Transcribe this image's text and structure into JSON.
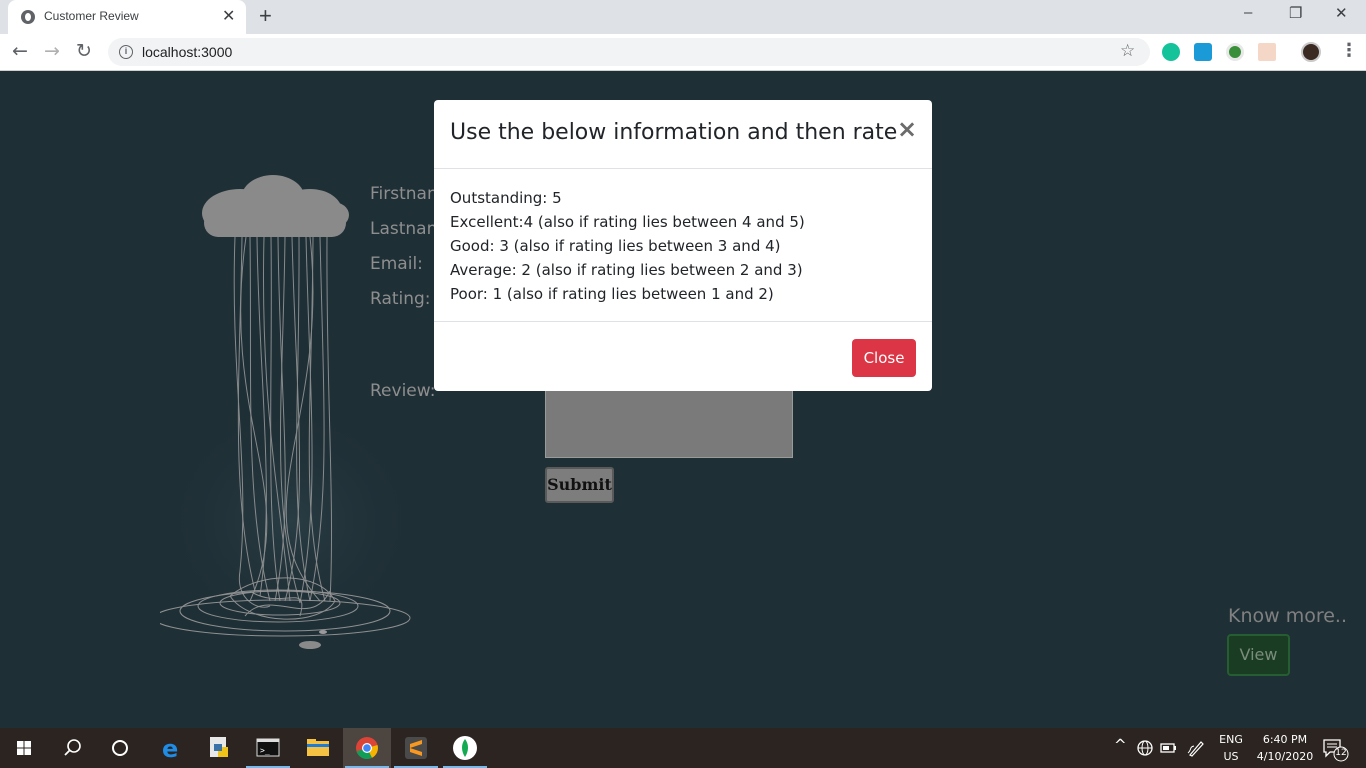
{
  "browser": {
    "tab_title": "Customer Review",
    "tab_close": "✕",
    "new_tab": "+",
    "url": "localhost:3000",
    "window_controls": [
      "–",
      "❐",
      "✕"
    ]
  },
  "form": {
    "labels": [
      "Firstnam",
      "Lastnam",
      "Email:",
      "Rating:",
      "Review:"
    ],
    "submit_label": "Submit"
  },
  "aside": {
    "know_more": "Know more..",
    "view_label": "View"
  },
  "modal": {
    "title": "Use the below information and then rate",
    "close_x": "×",
    "lines": [
      "Outstanding: 5",
      "Excellent:4 (also if rating lies between 4 and 5)",
      "Good: 3 (also if rating lies between 3 and 4)",
      "Average: 2 (also if rating lies between 2 and 3)",
      "Poor: 1 (also if rating lies between 1 and 2)"
    ],
    "close_label": "Close"
  },
  "taskbar": {
    "language": "ENG",
    "region": "US",
    "time": "6:40 PM",
    "date": "4/10/2020",
    "notification_count": "12"
  },
  "colors": {
    "page_bg": "#1f2f36",
    "close_button": "#dc3545",
    "view_button": "#193c22"
  }
}
